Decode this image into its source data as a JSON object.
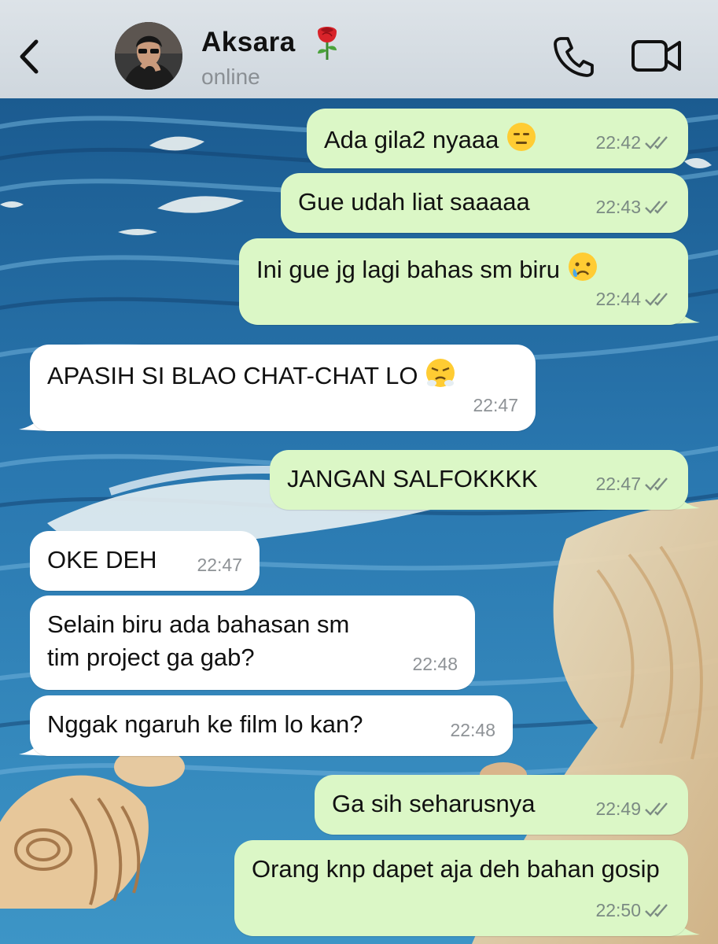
{
  "header": {
    "contact_name": "Aksara",
    "contact_emoji": "🌹",
    "status": "online",
    "icons": [
      "chevron-left-icon",
      "phone-icon",
      "video-camera-icon"
    ]
  },
  "colors": {
    "header_bg": "#d3dae0",
    "outgoing_bubble": "#dbf7c6",
    "incoming_bubble": "#ffffff",
    "timestamp": "#7b8a83"
  },
  "messages": [
    {
      "dir": "out",
      "text": "Ada gila2 nyaaa",
      "emoji": "expressionless-face",
      "time": "22:42",
      "ticks": "read"
    },
    {
      "dir": "out",
      "text": "Gue udah liat saaaaa",
      "time": "22:43",
      "ticks": "read"
    },
    {
      "dir": "out",
      "text": "Ini gue jg lagi bahas sm biru",
      "emoji": "crying-face",
      "time": "22:44",
      "ticks": "read"
    },
    {
      "dir": "in",
      "text": "APASIH SI BLAO CHAT-CHAT LO",
      "emoji": "steam-from-nose-face",
      "time": "22:47"
    },
    {
      "dir": "out",
      "text": "JANGAN SALFOKKKK",
      "time": "22:47",
      "ticks": "read"
    },
    {
      "dir": "in",
      "text": "OKE DEH",
      "time": "22:47"
    },
    {
      "dir": "in",
      "text": "Selain biru ada bahasan sm tim project ga gab?",
      "time": "22:48"
    },
    {
      "dir": "in",
      "text": "Nggak ngaruh ke film lo kan?",
      "time": "22:48"
    },
    {
      "dir": "out",
      "text": "Ga sih seharusnya",
      "time": "22:49",
      "ticks": "read"
    },
    {
      "dir": "out",
      "text": "Orang knp dapet aja deh bahan gosip",
      "time": "22:50",
      "ticks": "read"
    }
  ]
}
